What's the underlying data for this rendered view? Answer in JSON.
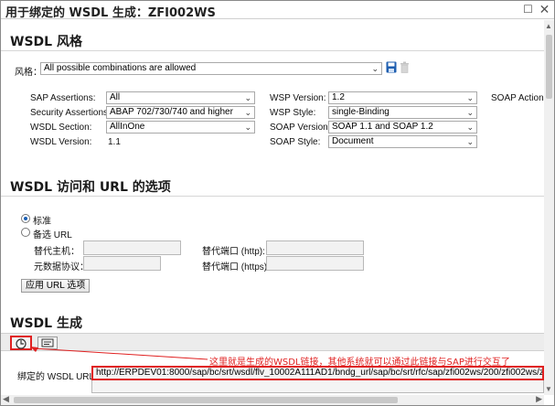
{
  "window": {
    "title": "用于绑定的 WSDL 生成：ZFI002WS",
    "maximize_glyph": "☐",
    "close_glyph": "✕"
  },
  "style_section": {
    "title": "WSDL 风格",
    "style_label": "风格：",
    "style_value": "All possible combinations are allowed",
    "save_icon": "save-icon",
    "delete_icon": "trash-icon",
    "fields": {
      "sap_assertions_label": "SAP Assertions:",
      "sap_assertions_value": "All",
      "security_assertions_label": "Security Assertions:",
      "security_assertions_value": "ABAP 702/730/740 and higher",
      "wsdl_section_label": "WSDL Section:",
      "wsdl_section_value": "AllInOne",
      "wsdl_version_label": "WSDL Version:",
      "wsdl_version_value": "1.1",
      "wsp_version_label": "WSP Version:",
      "wsp_version_value": "1.2",
      "wsp_style_label": "WSP Style:",
      "wsp_style_value": "single-Binding",
      "soap_version_label": "SOAP Version:",
      "soap_version_value": "SOAP 1.1 and SOAP 1.2",
      "soap_style_label": "SOAP Style:",
      "soap_style_value": "Document",
      "soap_action_label": "SOAP Action:"
    }
  },
  "access_section": {
    "title": "WSDL 访问和 URL 的选项",
    "radio_standard": "标准",
    "radio_alternative": "备选 URL",
    "alt_host_label": "替代主机：",
    "metadata_protocol_label": "元数据协议：",
    "alt_port_http_label": "替代端口 (http):",
    "alt_port_https_label": "替代端口 (https):",
    "apply_button": "应用 URL 选项"
  },
  "generate_section": {
    "title": "WSDL 生成",
    "toolbar_icons": [
      "generate-icon",
      "display-icon"
    ],
    "annotation": "这里就是生成的WSDL链接，其他系统就可以通过此链接与SAP进行交互了",
    "url_label": "绑定的 WSDL URL:",
    "url_value": "http://ERPDEV01:8000/sap/bc/srt/wsdl/flv_10002A111AD1/bndg_url/sap/bc/srt/rfc/sap/zfi002ws/200/zfi002ws/zfi002ws?sap-c"
  },
  "colors": {
    "annotation": "#e02020",
    "radio_selected": "#1a5fb4",
    "save_icon": "#1f5fb0"
  }
}
